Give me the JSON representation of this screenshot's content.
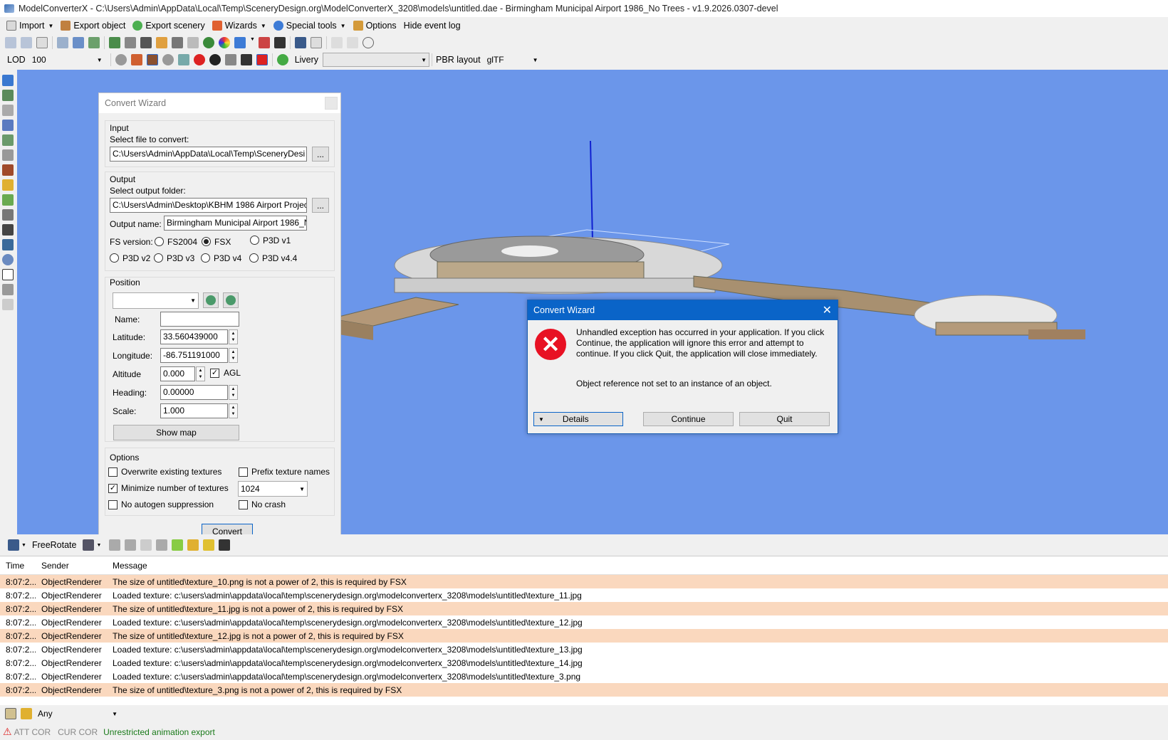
{
  "window": {
    "title": "ModelConverterX - C:\\Users\\Admin\\AppData\\Local\\Temp\\SceneryDesign.org\\ModelConverterX_3208\\models\\untitled.dae - Birmingham Municipal Airport 1986_No Trees - v1.9.2026.0307-devel"
  },
  "menu": {
    "import": "Import",
    "export_object": "Export object",
    "export_scenery": "Export scenery",
    "wizards": "Wizards",
    "special_tools": "Special tools",
    "options": "Options",
    "hide_event_log": "Hide event log"
  },
  "toolbar3": {
    "lod_label": "LOD",
    "lod_value": "100",
    "livery_label": "Livery",
    "livery_value": "",
    "pbr_label": "PBR layout",
    "pbr_value": "glTF"
  },
  "wizard": {
    "title": "Convert Wizard",
    "input_group": "Input",
    "select_file_label": "Select file to convert:",
    "file_value": "C:\\Users\\Admin\\AppData\\Local\\Temp\\SceneryDesi",
    "browse": "...",
    "output_group": "Output",
    "select_folder_label": "Select output folder:",
    "folder_value": "C:\\Users\\Admin\\Desktop\\KBHM 1986 Airport Projec",
    "output_name_label": "Output name:",
    "output_name_value": "Birmingham Municipal Airport 1986_N",
    "fs_version_label": "FS version:",
    "fs_options": [
      "FS2004",
      "FSX",
      "P3D v1",
      "P3D v2",
      "P3D v3",
      "P3D v4",
      "P3D v4.4"
    ],
    "fs_selected": "FSX",
    "position_group": "Position",
    "name_label": "Name:",
    "name_value": "",
    "latitude_label": "Latitude:",
    "latitude_value": "33.560439000",
    "longitude_label": "Longitude:",
    "longitude_value": "-86.751191000",
    "altitude_label": "Altitude",
    "altitude_value": "0.000",
    "agl_label": "AGL",
    "heading_label": "Heading:",
    "heading_value": "0.00000",
    "scale_label": "Scale:",
    "scale_value": "1.000",
    "show_map": "Show map",
    "options_group": "Options",
    "overwrite_textures": "Overwrite existing textures",
    "prefix_texture_names": "Prefix texture names",
    "minimize_textures": "Minimize number of textures",
    "texture_size": "1024",
    "no_autogen": "No autogen suppression",
    "no_crash": "No crash",
    "convert": "Convert"
  },
  "error_dialog": {
    "title": "Convert Wizard",
    "message1": "Unhandled exception has occurred in your application. If you click Continue, the application will ignore this error and attempt to continue. If you click Quit, the application will close immediately.",
    "message2": "Object reference not set to an instance of an object.",
    "details": "Details",
    "continue": "Continue",
    "quit": "Quit"
  },
  "bottom_toolbar": {
    "mode": "FreeRotate"
  },
  "log": {
    "columns": [
      "Time",
      "Sender",
      "Message"
    ],
    "rows": [
      {
        "time": "8:07:2...",
        "sender": "ObjectRenderer",
        "message": "The size of untitled\\texture_10.png is not a power of 2, this is required by FSX",
        "warn": true
      },
      {
        "time": "8:07:2...",
        "sender": "ObjectRenderer",
        "message": "Loaded texture: c:\\users\\admin\\appdata\\local\\temp\\scenerydesign.org\\modelconverterx_3208\\models\\untitled\\texture_11.jpg",
        "warn": false
      },
      {
        "time": "8:07:2...",
        "sender": "ObjectRenderer",
        "message": "The size of untitled\\texture_11.jpg is not a power of 2, this is required by FSX",
        "warn": true
      },
      {
        "time": "8:07:2...",
        "sender": "ObjectRenderer",
        "message": "Loaded texture: c:\\users\\admin\\appdata\\local\\temp\\scenerydesign.org\\modelconverterx_3208\\models\\untitled\\texture_12.jpg",
        "warn": false
      },
      {
        "time": "8:07:2...",
        "sender": "ObjectRenderer",
        "message": "The size of untitled\\texture_12.jpg is not a power of 2, this is required by FSX",
        "warn": true
      },
      {
        "time": "8:07:2...",
        "sender": "ObjectRenderer",
        "message": "Loaded texture: c:\\users\\admin\\appdata\\local\\temp\\scenerydesign.org\\modelconverterx_3208\\models\\untitled\\texture_13.jpg",
        "warn": false
      },
      {
        "time": "8:07:2...",
        "sender": "ObjectRenderer",
        "message": "Loaded texture: c:\\users\\admin\\appdata\\local\\temp\\scenerydesign.org\\modelconverterx_3208\\models\\untitled\\texture_14.jpg",
        "warn": false
      },
      {
        "time": "8:07:2...",
        "sender": "ObjectRenderer",
        "message": "Loaded texture: c:\\users\\admin\\appdata\\local\\temp\\scenerydesign.org\\modelconverterx_3208\\models\\untitled\\texture_3.png",
        "warn": false
      },
      {
        "time": "8:07:2...",
        "sender": "ObjectRenderer",
        "message": "The size of untitled\\texture_3.png is not a power of 2, this is required by FSX",
        "warn": true
      }
    ]
  },
  "filter": {
    "value": "Any"
  },
  "status": {
    "att_cor": "ATT COR",
    "cur_cor": "CUR COR",
    "anim": "Unrestricted animation export"
  },
  "colors": {
    "viewport": "#6b96ea",
    "warn_row": "#fad8be",
    "dialog_title": "#0a64c8",
    "error": "#e81123"
  }
}
